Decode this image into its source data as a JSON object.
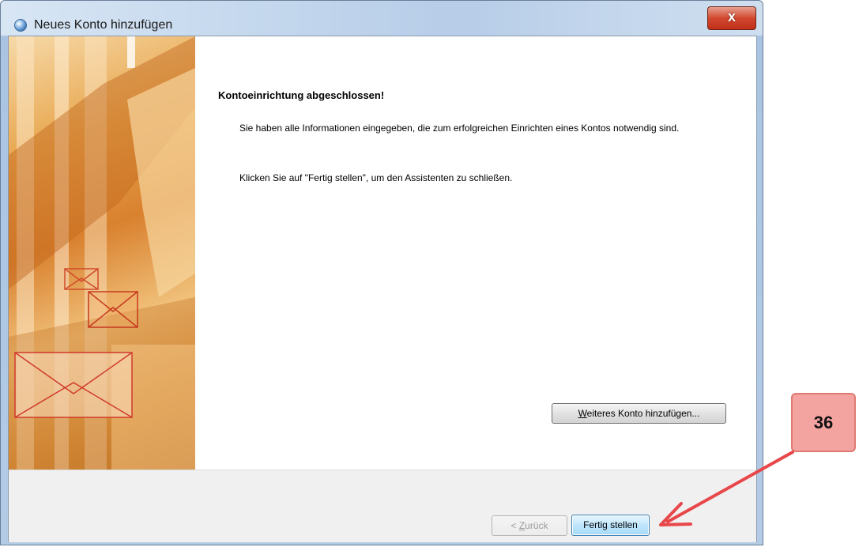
{
  "window": {
    "title": "Neues Konto hinzufügen",
    "close_glyph": "x"
  },
  "content": {
    "heading": "Kontoeinrichtung abgeschlossen!",
    "paragraph1": "Sie haben alle Informationen eingegeben, die zum erfolgreichen Einrichten eines Kontos notwendig sind.",
    "paragraph2": "Klicken Sie auf \"Fertig stellen\", um den Assistenten zu schließen."
  },
  "buttons": {
    "add_another_underline": "W",
    "add_another_rest": "eiteres Konto hinzufügen...",
    "back_prefix": "< ",
    "back_underline": "Z",
    "back_rest": "urück",
    "finish": "Fertig stellen"
  },
  "annotation": {
    "step_number": "36",
    "color": "#e8474a"
  },
  "icons": [
    "window-app-icon",
    "close-icon",
    "envelope-icon"
  ]
}
